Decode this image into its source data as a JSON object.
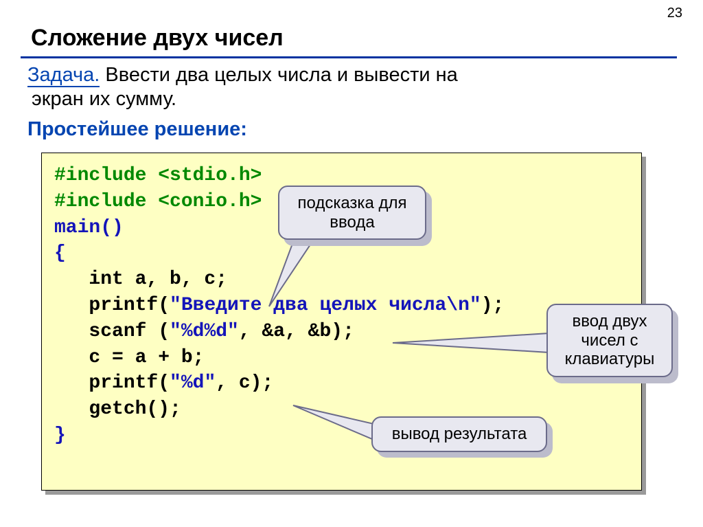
{
  "pageNumber": "23",
  "title": "Сложение двух чисел",
  "task": {
    "label": "Задача.",
    "text_line1": " Ввести два целых числа и вывести на",
    "text_line2": "экран их сумму."
  },
  "solutionLabel": "Простейшее решение:",
  "code": {
    "cmt1": "#include <stdio.h>",
    "cmt2": "#include <conio.h>",
    "main": "main()",
    "open": "{",
    "l1": "   int a, b, c;",
    "l2a": "   printf(",
    "l2b": "\"Введите два целых числа\\n\"",
    "l2c": ");",
    "l3a": "   scanf (",
    "l3b": "\"%d%d\"",
    "l3c": ", &a, &b);",
    "l4": "   c = a + b;",
    "l5a": "   printf(",
    "l5b": "\"%d\"",
    "l5c": ", c);",
    "l6": "   getch();",
    "close": "}"
  },
  "callouts": {
    "hint": "подсказка для\nввода",
    "input": "ввод двух\nчисел с\nклавиатуры",
    "output": "вывод результата"
  }
}
